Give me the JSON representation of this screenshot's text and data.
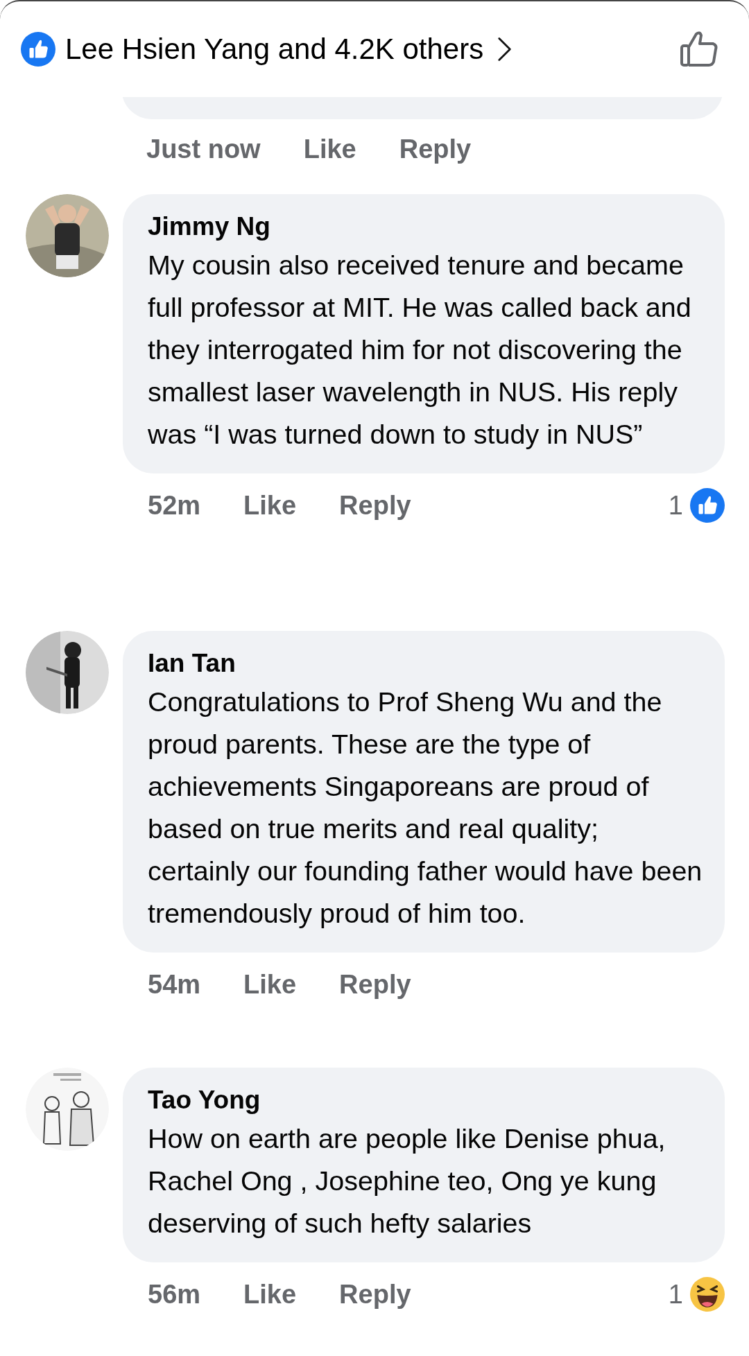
{
  "header": {
    "reactions_summary": "Lee Hsien Yang and 4.2K others"
  },
  "previous_comment": {
    "time": "Just now",
    "like_label": "Like",
    "reply_label": "Reply"
  },
  "comments": [
    {
      "author": "Jimmy Ng",
      "text": "My cousin also received tenure and became full professor at MIT. He was called back and they interrogated him for not discovering the smallest laser wavelength in NUS. His reply was “I was turned down to study in NUS”",
      "time": "52m",
      "like_label": "Like",
      "reply_label": "Reply",
      "reaction_count": "1",
      "reaction": {
        "kind": "like"
      }
    },
    {
      "author": "Ian Tan",
      "text": "Congratulations to Prof Sheng Wu and the proud parents. These are the type of achievements Singaporeans are proud of based on true merits and real quality; certainly our founding father would have been tremendously proud of him too.",
      "time": "54m",
      "like_label": "Like",
      "reply_label": "Reply"
    },
    {
      "author": "Tao Yong",
      "text": "How on earth are people like Denise phua, Rachel Ong , Josephine teo, Ong ye kung deserving of such hefty salaries",
      "time": "56m",
      "like_label": "Like",
      "reply_label": "Reply",
      "reaction_count": "1",
      "reaction": {
        "kind": "haha"
      }
    }
  ]
}
